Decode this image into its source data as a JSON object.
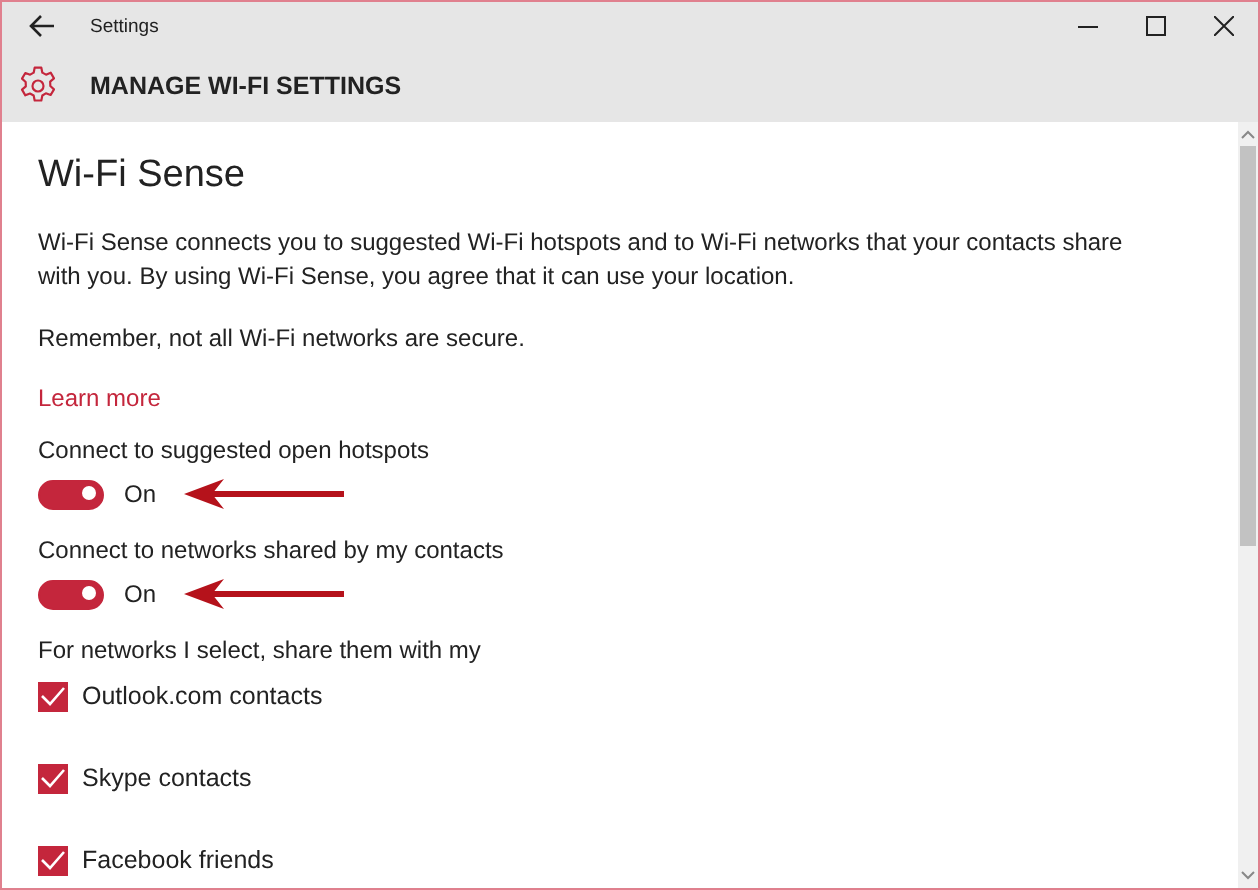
{
  "window": {
    "title": "Settings"
  },
  "header": {
    "title": "MANAGE WI-FI SETTINGS"
  },
  "section": {
    "heading": "Wi-Fi Sense",
    "paragraphs": [
      "Wi-Fi Sense connects you to suggested Wi-Fi hotspots and to Wi-Fi networks that your contacts share with you. By using Wi-Fi Sense, you agree that it can use your location.",
      "Remember, not all Wi-Fi networks are secure."
    ],
    "link": "Learn more"
  },
  "toggles": [
    {
      "label": "Connect to suggested open hotspots",
      "on": true,
      "state_text": "On",
      "annotated": true
    },
    {
      "label": "Connect to networks shared by my contacts",
      "on": true,
      "state_text": "On",
      "annotated": true
    }
  ],
  "share_label": "For networks I select, share them with my",
  "checkboxes": [
    {
      "label": "Outlook.com contacts",
      "checked": true
    },
    {
      "label": "Skype contacts",
      "checked": true
    },
    {
      "label": "Facebook friends",
      "checked": true
    }
  ]
}
